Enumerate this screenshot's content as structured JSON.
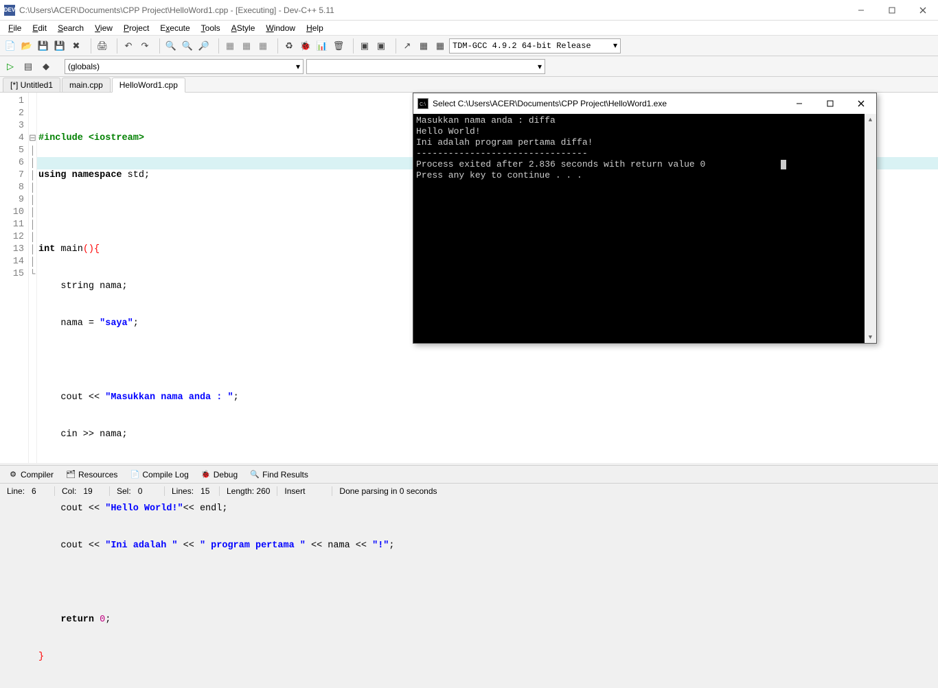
{
  "title": "C:\\Users\\ACER\\Documents\\CPP Project\\HelloWord1.cpp - [Executing] - Dev-C++ 5.11",
  "menus": [
    "File",
    "Edit",
    "Search",
    "View",
    "Project",
    "Execute",
    "Tools",
    "AStyle",
    "Window",
    "Help"
  ],
  "compiler_dd": "TDM-GCC 4.9.2 64-bit Release",
  "globals_dd": "(globals)",
  "tabs": [
    {
      "label": "[*] Untitled1",
      "active": false
    },
    {
      "label": "main.cpp",
      "active": false
    },
    {
      "label": "HelloWord1.cpp",
      "active": true
    }
  ],
  "code_lines_count": 15,
  "highlight_line": 6,
  "code": {
    "l1": {
      "a": "#include",
      "b": "<iostream>"
    },
    "l2": {
      "a": "using",
      "b": "namespace",
      "c": "std;"
    },
    "l4": {
      "a": "int",
      "b": "main",
      "c": "()",
      "d": "{"
    },
    "l5": {
      "a": "string nama;"
    },
    "l6": {
      "a": "nama = ",
      "b": "\"saya\"",
      "c": ";"
    },
    "l8": {
      "a": "cout << ",
      "b": "\"Masukkan nama anda : \"",
      "c": ";"
    },
    "l9": {
      "a": "cin >> nama;"
    },
    "l11": {
      "a": "cout << ",
      "b": "\"Hello World!\"",
      "c": "<< endl;"
    },
    "l12": {
      "a": "cout << ",
      "b": "\"Ini adalah \"",
      "c": " << ",
      "d": "\" program pertama \"",
      "e": " << nama << ",
      "f": "\"!\"",
      "g": ";"
    },
    "l14": {
      "a": "return",
      "b": "0",
      "c": ";"
    },
    "l15": {
      "a": "}"
    }
  },
  "console": {
    "title": "Select C:\\Users\\ACER\\Documents\\CPP Project\\HelloWord1.exe",
    "line1": "Masukkan nama anda : diffa",
    "line2": "Hello World!",
    "line3": "Ini adalah  program pertama diffa!",
    "line4": "--------------------------------",
    "line5": "Process exited after 2.836 seconds with return value 0",
    "line6": "Press any key to continue . . ."
  },
  "bottom_tabs": [
    {
      "icon": "⚙",
      "label": "Compiler"
    },
    {
      "icon": "🗂",
      "label": "Resources"
    },
    {
      "icon": "📄",
      "label": "Compile Log"
    },
    {
      "icon": "🐞",
      "label": "Debug"
    },
    {
      "icon": "🔍",
      "label": "Find Results"
    }
  ],
  "status": {
    "line_lbl": "Line:",
    "line_val": "6",
    "col_lbl": "Col:",
    "col_val": "19",
    "sel_lbl": "Sel:",
    "sel_val": "0",
    "lines_lbl": "Lines:",
    "lines_val": "15",
    "len_lbl": "Length:",
    "len_val": "260",
    "mode": "Insert",
    "msg": "Done parsing in 0 seconds"
  }
}
